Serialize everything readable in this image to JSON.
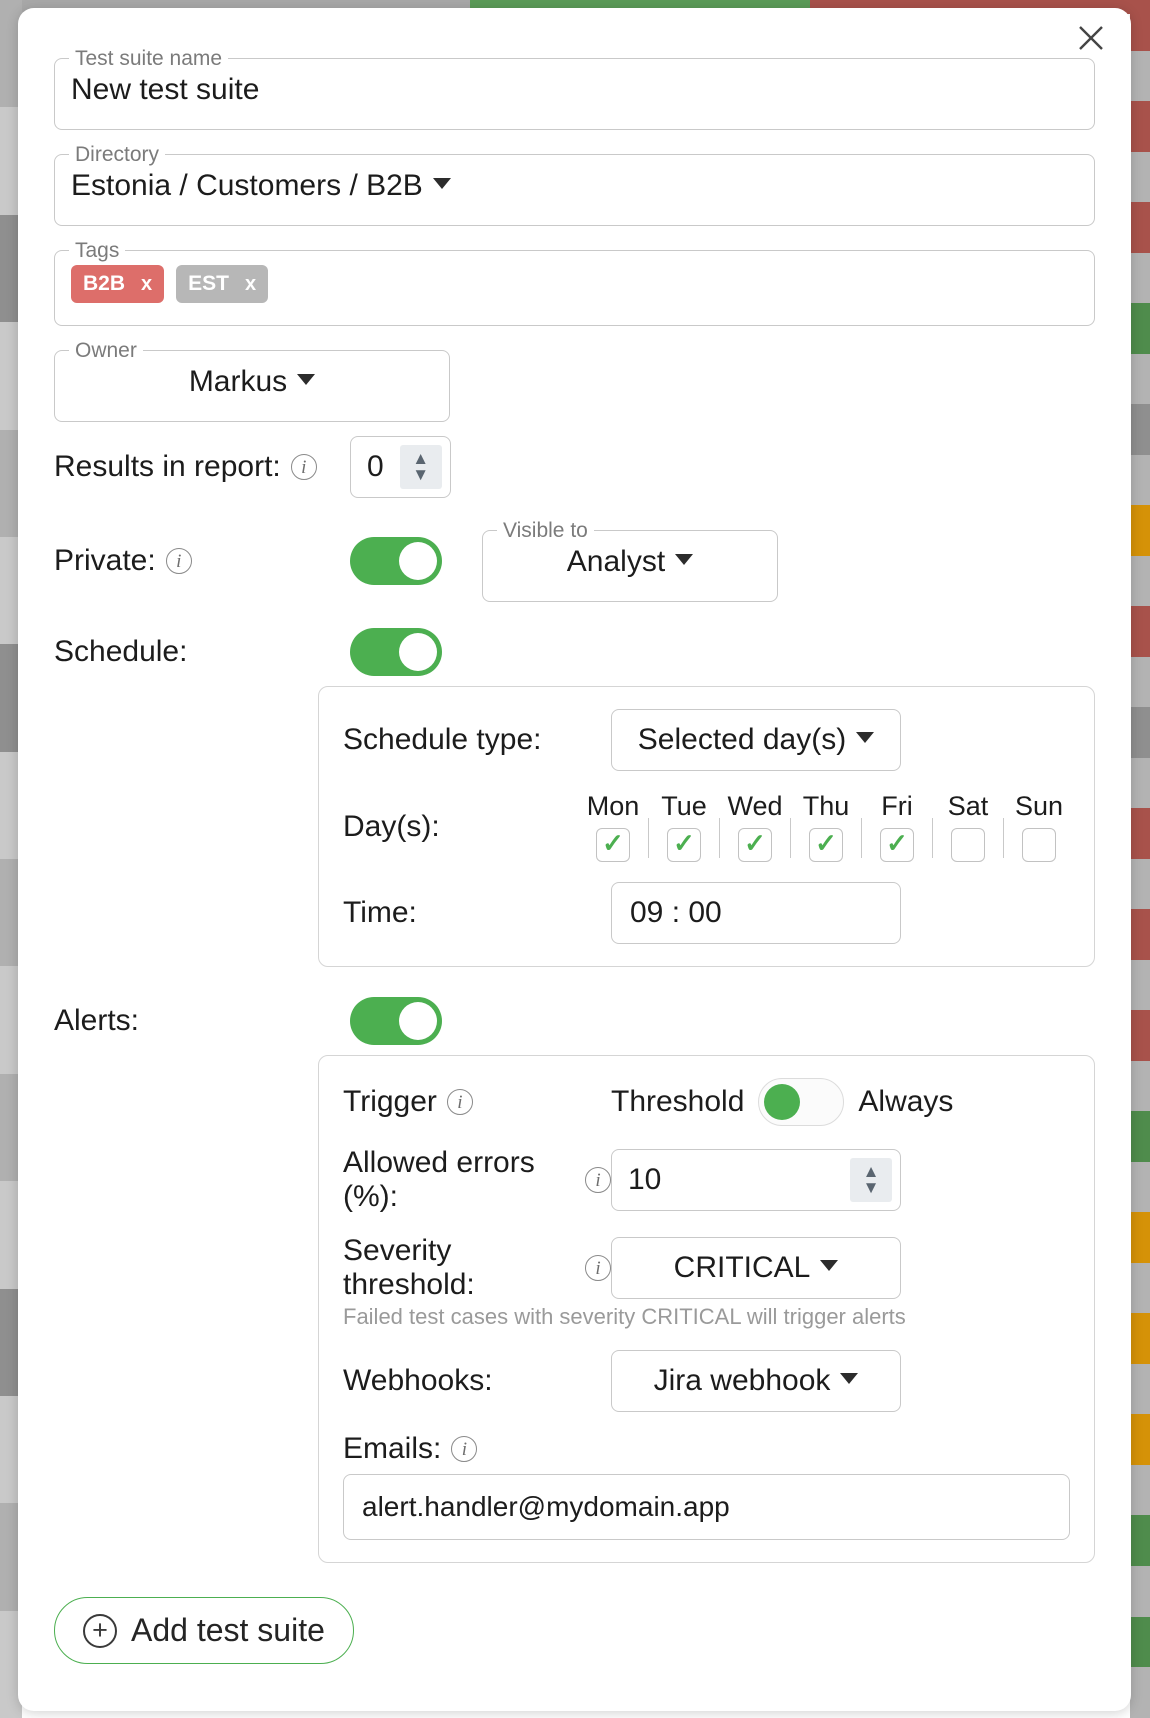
{
  "dialog": {
    "close_icon": "close-icon"
  },
  "fields": {
    "test_suite_name": {
      "legend": "Test suite name",
      "value": "New test suite"
    },
    "directory": {
      "legend": "Directory",
      "value": "Estonia / Customers / B2B"
    },
    "tags": {
      "legend": "Tags",
      "items": [
        {
          "label": "B2B",
          "remove": "x",
          "color": "#dd6e6a"
        },
        {
          "label": "EST",
          "remove": "x",
          "color": "#b7b7b7"
        }
      ]
    },
    "owner": {
      "legend": "Owner",
      "value": "Markus"
    },
    "results_in_report": {
      "label": "Results in report:",
      "info": "info-icon",
      "value": "0"
    },
    "private": {
      "label": "Private:",
      "info": "info-icon",
      "enabled": true
    },
    "visible_to": {
      "legend": "Visible to",
      "value": "Analyst"
    }
  },
  "schedule": {
    "label": "Schedule:",
    "enabled": true,
    "type_label": "Schedule type:",
    "type_value": "Selected day(s)",
    "days_label": "Day(s):",
    "days": [
      {
        "name": "Mon",
        "checked": true
      },
      {
        "name": "Tue",
        "checked": true
      },
      {
        "name": "Wed",
        "checked": true
      },
      {
        "name": "Thu",
        "checked": true
      },
      {
        "name": "Fri",
        "checked": true
      },
      {
        "name": "Sat",
        "checked": false
      },
      {
        "name": "Sun",
        "checked": false
      }
    ],
    "time_label": "Time:",
    "time_value": "09 : 00"
  },
  "alerts": {
    "label": "Alerts:",
    "enabled": true,
    "trigger_label": "Trigger",
    "trigger_info": "info-icon",
    "trigger_left_option": "Threshold",
    "trigger_right_option": "Always",
    "trigger_selected": "Threshold",
    "allowed_errors_label": "Allowed errors (%):",
    "allowed_errors_info": "info-icon",
    "allowed_errors_value": "10",
    "severity_label": "Severity threshold:",
    "severity_info": "info-icon",
    "severity_value": "CRITICAL",
    "severity_hint": "Failed test cases with severity CRITICAL will trigger alerts",
    "webhooks_label": "Webhooks:",
    "webhooks_value": "Jira webhook",
    "emails_label": "Emails:",
    "emails_info": "info-icon",
    "emails_value": "alert.handler@mydomain.app"
  },
  "footer": {
    "add_button_label": "Add test suite",
    "add_button_icon": "plus-circle-icon"
  },
  "background": {
    "top_bar_segments": [
      "#a8a8a8",
      "#5b9b58",
      "#a8524b"
    ],
    "right_strip_segments": [
      "#a8524b",
      "#b3b3b3",
      "#a8524b",
      "#b3b3b3",
      "#a8524b",
      "#b3b3b3",
      "#4f8c4c",
      "#b3b3b3",
      "#8f8f8f",
      "#b3b3b3",
      "#d59208",
      "#b3b3b3",
      "#a8524b",
      "#b3b3b3",
      "#8f8f8f",
      "#b3b3b3",
      "#a8524b",
      "#b3b3b3",
      "#a8524b",
      "#b3b3b3",
      "#a8524b",
      "#b3b3b3",
      "#4f8c4c",
      "#b3b3b3",
      "#d59208",
      "#b3b3b3",
      "#d59208",
      "#b3b3b3",
      "#d59208",
      "#b3b3b3",
      "#4f8c4c",
      "#b3b3b3",
      "#4f8c4c",
      "#b3b3b3"
    ],
    "left_strip_segments": [
      "#b0b0b0",
      "#c9c9c9",
      "#8f8f8f",
      "#c9c9c9",
      "#b0b0b0",
      "#c9c9c9",
      "#8f8f8f",
      "#c9c9c9",
      "#b0b0b0",
      "#c9c9c9",
      "#b0b0b0",
      "#c9c9c9",
      "#8f8f8f",
      "#c9c9c9",
      "#b0b0b0",
      "#c9c9c9"
    ]
  },
  "colors": {
    "accent_green": "#4caf50",
    "danger_red": "#a8524b",
    "tag_red": "#dd6e6a",
    "tag_gray": "#b7b7b7"
  }
}
